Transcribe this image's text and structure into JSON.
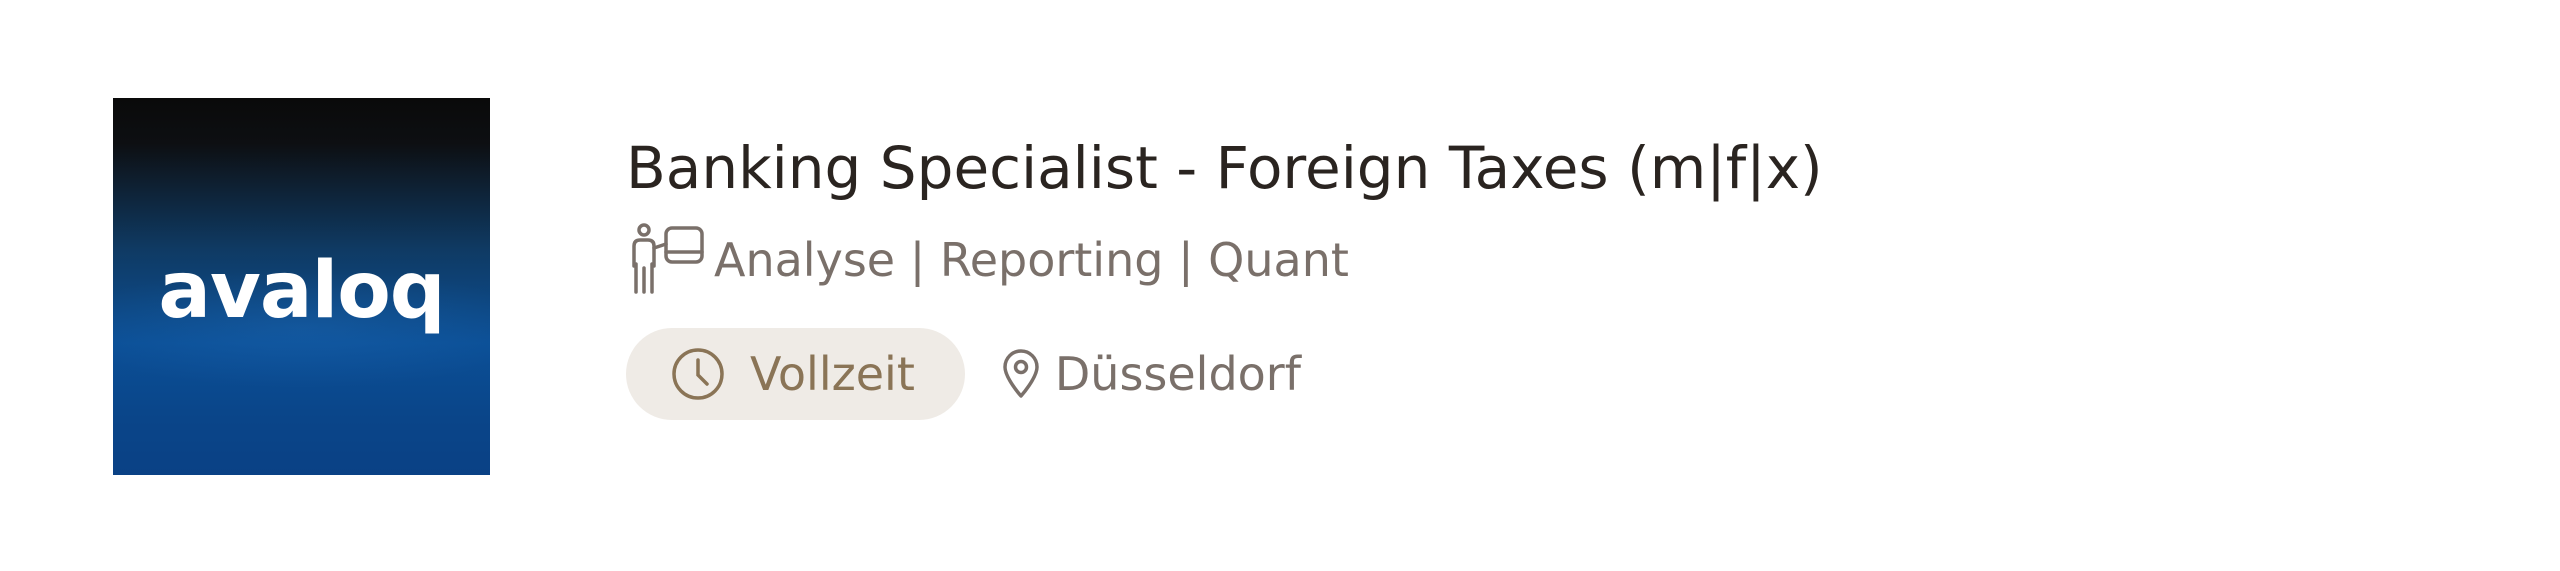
{
  "job": {
    "company_logo_text": "avaloq",
    "title": "Banking Specialist - Foreign Taxes (m|f|x)",
    "category": "Analyse | Reporting | Quant",
    "employment_type": "Vollzeit",
    "location": "Düsseldorf"
  },
  "icons": {
    "category": "presenter-board-icon",
    "employment_type": "clock-icon",
    "location": "map-pin-icon"
  },
  "colors": {
    "title": "#2a2420",
    "muted_text": "#7a706a",
    "badge_bg": "#efebe6",
    "badge_text": "#8a7456",
    "logo_bg_top": "#0a0a0a",
    "logo_bg_bottom": "#0a4185"
  }
}
